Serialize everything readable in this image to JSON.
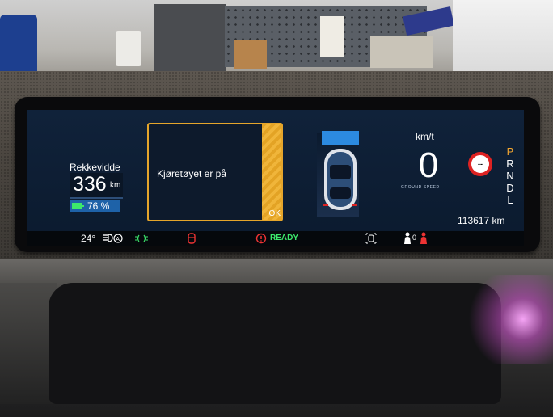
{
  "range": {
    "label": "Rekkevidde",
    "value": "336",
    "unit": "km"
  },
  "battery": {
    "percent": "76 %"
  },
  "message": {
    "text": "Kjøretøyet er på",
    "ok_label": "OK"
  },
  "speed": {
    "unit": "km/t",
    "value": "0",
    "caption": "GROUND SPEED"
  },
  "speed_limit_sign": {
    "text": "--"
  },
  "gears": {
    "items": [
      "P",
      "R",
      "N",
      "D",
      "L"
    ],
    "active": "P"
  },
  "odometer": {
    "value": "113617 km"
  },
  "status_bar": {
    "temperature": "24°",
    "ready_label": "READY",
    "seatbelt_count": "0"
  },
  "colors": {
    "screen_bg": "#0b1a2e",
    "accent_orange": "#e5a52b",
    "ready_green": "#3de86c",
    "warning_red": "#d22",
    "lead_blue": "#2c8ae0"
  }
}
